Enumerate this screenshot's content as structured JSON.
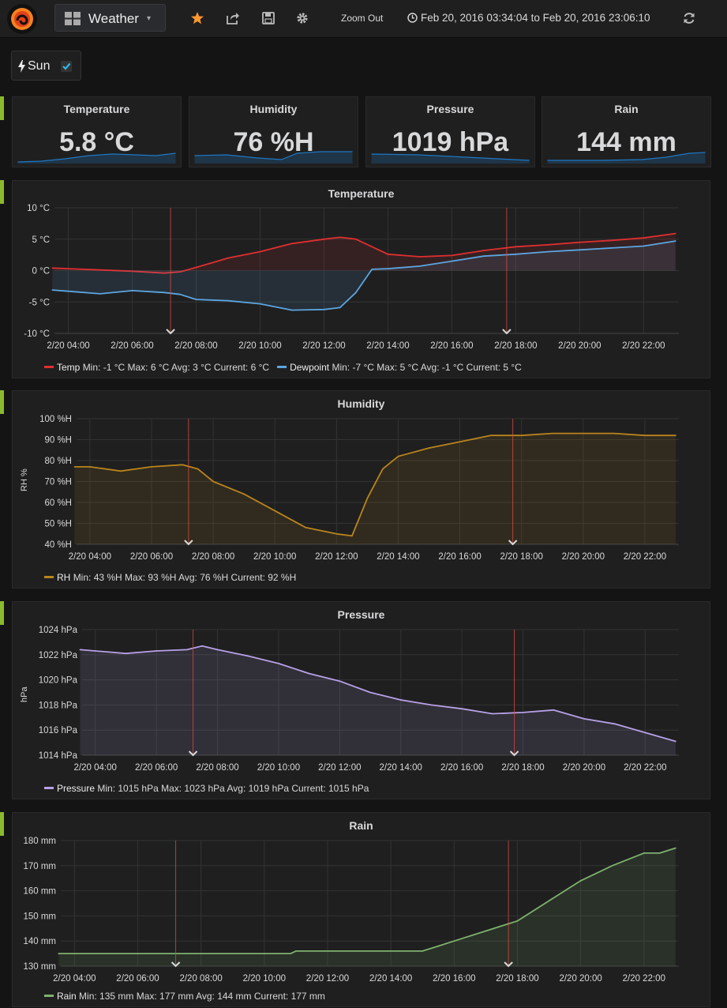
{
  "navbar": {
    "dashboard_title": "Weather",
    "zoom_out": "Zoom Out",
    "time_range": "Feb 20, 2016 03:34:04 to Feb 20, 2016 23:06:10",
    "star_color": "#ff9830"
  },
  "toggle": {
    "label": "Sun",
    "checked": true
  },
  "stats": [
    {
      "title": "Temperature",
      "value": "5.8 °C"
    },
    {
      "title": "Humidity",
      "value": "76 %H"
    },
    {
      "title": "Pressure",
      "value": "1019 hPa"
    },
    {
      "title": "Rain",
      "value": "144 mm"
    }
  ],
  "chart_data": [
    {
      "type": "line",
      "title": "Temperature",
      "x": [
        "03:30",
        "04:00",
        "05:00",
        "06:00",
        "07:00",
        "07:30",
        "08:00",
        "09:00",
        "10:00",
        "11:00",
        "12:00",
        "12:30",
        "13:00",
        "13:30",
        "14:00",
        "15:00",
        "16:00",
        "17:00",
        "18:00",
        "19:00",
        "20:00",
        "21:00",
        "22:00",
        "23:00"
      ],
      "series": [
        {
          "name": "Temp",
          "color": "#e02f2f",
          "values": [
            0.4,
            0.3,
            0.1,
            -0.1,
            -0.4,
            -0.2,
            0.5,
            2.0,
            3.0,
            4.3,
            5.0,
            5.3,
            5.0,
            3.8,
            2.6,
            2.2,
            2.4,
            3.2,
            3.8,
            4.1,
            4.5,
            4.8,
            5.2,
            5.9
          ]
        },
        {
          "name": "Dewpoint",
          "color": "#5ca5e0",
          "values": [
            -3.1,
            -3.3,
            -3.7,
            -3.2,
            -3.5,
            -3.8,
            -4.6,
            -4.8,
            -5.3,
            -6.3,
            -6.2,
            -5.9,
            -3.5,
            0.2,
            0.3,
            0.7,
            1.5,
            2.3,
            2.6,
            3.0,
            3.3,
            3.6,
            3.9,
            4.7
          ]
        }
      ],
      "yticks": [
        "10 °C",
        "5 °C",
        "0 °C",
        "-5 °C",
        "-10 °C"
      ],
      "ylim": [
        -10,
        10
      ],
      "xticks": [
        "2/20 04:00",
        "2/20 06:00",
        "2/20 08:00",
        "2/20 10:00",
        "2/20 12:00",
        "2/20 14:00",
        "2/20 16:00",
        "2/20 18:00",
        "2/20 20:00",
        "2/20 22:00"
      ],
      "ylabel": "",
      "annotations": [
        "07:12",
        "17:43"
      ],
      "legend": [
        {
          "name": "Temp",
          "color": "#e02f2f",
          "stats": "Min: -1 °C  Max: 6 °C  Avg: 3 °C  Current: 6 °C"
        },
        {
          "name": "Dewpoint",
          "color": "#5ca5e0",
          "stats": "Min: -7 °C  Max: 5 °C  Avg: -1 °C  Current: 5 °C"
        }
      ]
    },
    {
      "type": "line",
      "title": "Humidity",
      "x": [
        "03:30",
        "04:00",
        "05:00",
        "06:00",
        "07:00",
        "07:30",
        "08:00",
        "09:00",
        "10:00",
        "11:00",
        "12:00",
        "12:30",
        "13:00",
        "13:30",
        "14:00",
        "15:00",
        "16:00",
        "17:00",
        "18:00",
        "19:00",
        "20:00",
        "21:00",
        "22:00",
        "23:00"
      ],
      "series": [
        {
          "name": "RH",
          "color": "#b9841c",
          "values": [
            77,
            77,
            75,
            77,
            78,
            76,
            70,
            64,
            56,
            48,
            45,
            44,
            62,
            76,
            82,
            86,
            89,
            92,
            92,
            93,
            93,
            93,
            92,
            92
          ]
        }
      ],
      "yticks": [
        "100 %H",
        "90 %H",
        "80 %H",
        "70 %H",
        "60 %H",
        "50 %H",
        "40 %H"
      ],
      "ylim": [
        40,
        100
      ],
      "xticks": [
        "2/20 04:00",
        "2/20 06:00",
        "2/20 08:00",
        "2/20 10:00",
        "2/20 12:00",
        "2/20 14:00",
        "2/20 16:00",
        "2/20 18:00",
        "2/20 20:00",
        "2/20 22:00"
      ],
      "ylabel": "RH %",
      "annotations": [
        "07:12",
        "17:43"
      ],
      "legend": [
        {
          "name": "RH",
          "color": "#b9841c",
          "stats": "Min: 43 %H  Max: 93 %H  Avg: 76 %H  Current: 92 %H"
        }
      ]
    },
    {
      "type": "line",
      "title": "Pressure",
      "x": [
        "03:30",
        "04:00",
        "05:00",
        "06:00",
        "07:00",
        "07:30",
        "08:00",
        "09:00",
        "10:00",
        "11:00",
        "12:00",
        "13:00",
        "14:00",
        "15:00",
        "16:00",
        "17:00",
        "18:00",
        "19:00",
        "20:00",
        "21:00",
        "22:00",
        "23:00"
      ],
      "series": [
        {
          "name": "Pressure",
          "color": "#b7a1e6",
          "values": [
            1022.4,
            1022.3,
            1022.1,
            1022.3,
            1022.4,
            1022.7,
            1022.4,
            1021.9,
            1021.3,
            1020.5,
            1019.9,
            1019.0,
            1018.4,
            1018.0,
            1017.7,
            1017.3,
            1017.4,
            1017.6,
            1016.9,
            1016.5,
            1015.8,
            1015.1
          ]
        }
      ],
      "yticks": [
        "1024 hPa",
        "1022 hPa",
        "1020 hPa",
        "1018 hPa",
        "1016 hPa",
        "1014 hPa"
      ],
      "ylim": [
        1014,
        1024
      ],
      "xticks": [
        "2/20 04:00",
        "2/20 06:00",
        "2/20 08:00",
        "2/20 10:00",
        "2/20 12:00",
        "2/20 14:00",
        "2/20 16:00",
        "2/20 18:00",
        "2/20 20:00",
        "2/20 22:00"
      ],
      "ylabel": "hPa",
      "annotations": [
        "07:12",
        "17:43"
      ],
      "legend": [
        {
          "name": "Pressure",
          "color": "#b7a1e6",
          "stats": "Min: 1015 hPa  Max: 1023 hPa  Avg: 1019 hPa  Current: 1015 hPa"
        }
      ]
    },
    {
      "type": "line",
      "title": "Rain",
      "x": [
        "03:30",
        "04:00",
        "06:00",
        "08:00",
        "10:00",
        "10:50",
        "11:00",
        "12:00",
        "14:00",
        "15:00",
        "15:30",
        "16:00",
        "17:00",
        "17:30",
        "18:00",
        "19:00",
        "20:00",
        "21:00",
        "22:00",
        "22:30",
        "23:00"
      ],
      "series": [
        {
          "name": "Rain",
          "color": "#7eb26d",
          "values": [
            135,
            135,
            135,
            135,
            135,
            135,
            136,
            136,
            136,
            136,
            138,
            140,
            144,
            146,
            148,
            156,
            164,
            170,
            175,
            175,
            177
          ]
        }
      ],
      "yticks": [
        "180 mm",
        "170 mm",
        "160 mm",
        "150 mm",
        "140 mm",
        "130 mm"
      ],
      "ylim": [
        130,
        180
      ],
      "xticks": [
        "2/20 04:00",
        "2/20 06:00",
        "2/20 08:00",
        "2/20 10:00",
        "2/20 12:00",
        "2/20 14:00",
        "2/20 16:00",
        "2/20 18:00",
        "2/20 20:00",
        "2/20 22:00"
      ],
      "ylabel": "",
      "annotations": [
        "07:12",
        "17:43"
      ],
      "legend": [
        {
          "name": "Rain",
          "color": "#7eb26d",
          "stats": "Min: 135 mm  Max: 177 mm  Avg: 144 mm  Current: 177 mm"
        }
      ]
    }
  ]
}
